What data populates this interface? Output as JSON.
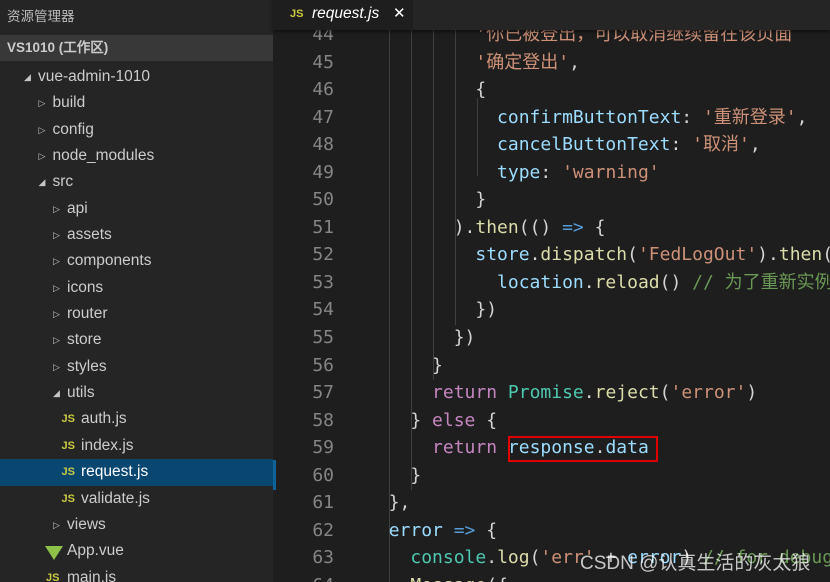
{
  "sidebar": {
    "title": "资源管理器",
    "workspace": "VS1010 (工作区)",
    "items": [
      {
        "label": "vue-admin-1010",
        "depth": 0,
        "type": "folder",
        "open": true
      },
      {
        "label": "build",
        "depth": 1,
        "type": "folder",
        "open": false
      },
      {
        "label": "config",
        "depth": 1,
        "type": "folder",
        "open": false
      },
      {
        "label": "node_modules",
        "depth": 1,
        "type": "folder",
        "open": false
      },
      {
        "label": "src",
        "depth": 1,
        "type": "folder",
        "open": true
      },
      {
        "label": "api",
        "depth": 2,
        "type": "folder",
        "open": false
      },
      {
        "label": "assets",
        "depth": 2,
        "type": "folder",
        "open": false
      },
      {
        "label": "components",
        "depth": 2,
        "type": "folder",
        "open": false
      },
      {
        "label": "icons",
        "depth": 2,
        "type": "folder",
        "open": false
      },
      {
        "label": "router",
        "depth": 2,
        "type": "folder",
        "open": false
      },
      {
        "label": "store",
        "depth": 2,
        "type": "folder",
        "open": false
      },
      {
        "label": "styles",
        "depth": 2,
        "type": "folder",
        "open": false
      },
      {
        "label": "utils",
        "depth": 2,
        "type": "folder",
        "open": true
      },
      {
        "label": "auth.js",
        "depth": 3,
        "type": "js"
      },
      {
        "label": "index.js",
        "depth": 3,
        "type": "js"
      },
      {
        "label": "request.js",
        "depth": 3,
        "type": "js",
        "selected": true
      },
      {
        "label": "validate.js",
        "depth": 3,
        "type": "js"
      },
      {
        "label": "views",
        "depth": 2,
        "type": "folder",
        "open": false
      },
      {
        "label": "App.vue",
        "depth": 2,
        "type": "vue"
      },
      {
        "label": "main.js",
        "depth": 2,
        "type": "js"
      }
    ]
  },
  "tab": {
    "icon_label": "JS",
    "name": "request.js",
    "close": "✕"
  },
  "icons": {
    "js": "JS",
    "folder_open": "◢",
    "folder_closed": "▷"
  },
  "colors": {
    "selection": "#094771",
    "highlight_box": "#e00000",
    "js_icon": "#cbcb41",
    "vue_icon": "#8dc149"
  },
  "code": [
    {
      "n": "44",
      "t": [
        [
          "          ",
          "p"
        ],
        [
          "'你已被登出，可以取消继续留在该页面",
          "s"
        ]
      ]
    },
    {
      "n": "45",
      "t": [
        [
          "          ",
          "p"
        ],
        [
          "'确定登出'",
          "s"
        ],
        [
          ",",
          "p"
        ]
      ]
    },
    {
      "n": "46",
      "t": [
        [
          "          {",
          "p"
        ]
      ]
    },
    {
      "n": "47",
      "t": [
        [
          "            ",
          "p"
        ],
        [
          "confirmButtonText",
          "v"
        ],
        [
          ": ",
          "p"
        ],
        [
          "'重新登录'",
          "s"
        ],
        [
          ",",
          "p"
        ]
      ]
    },
    {
      "n": "48",
      "t": [
        [
          "            ",
          "p"
        ],
        [
          "cancelButtonText",
          "v"
        ],
        [
          ": ",
          "p"
        ],
        [
          "'取消'",
          "s"
        ],
        [
          ",",
          "p"
        ]
      ]
    },
    {
      "n": "49",
      "t": [
        [
          "            ",
          "p"
        ],
        [
          "type",
          "v"
        ],
        [
          ": ",
          "p"
        ],
        [
          "'warning'",
          "s"
        ]
      ]
    },
    {
      "n": "50",
      "t": [
        [
          "          }",
          "p"
        ]
      ]
    },
    {
      "n": "51",
      "t": [
        [
          "        ).",
          "p"
        ],
        [
          "then",
          "f"
        ],
        [
          "(() ",
          "p"
        ],
        [
          "=>",
          "b"
        ],
        [
          " {",
          "p"
        ]
      ]
    },
    {
      "n": "52",
      "t": [
        [
          "          ",
          "p"
        ],
        [
          "store",
          "v"
        ],
        [
          ".",
          "p"
        ],
        [
          "dispatch",
          "f"
        ],
        [
          "(",
          "p"
        ],
        [
          "'FedLogOut'",
          "s"
        ],
        [
          ").",
          "p"
        ],
        [
          "then",
          "f"
        ],
        [
          "(() => {",
          "p"
        ]
      ]
    },
    {
      "n": "53",
      "t": [
        [
          "            ",
          "p"
        ],
        [
          "location",
          "v"
        ],
        [
          ".",
          "p"
        ],
        [
          "reload",
          "f"
        ],
        [
          "() ",
          "p"
        ],
        [
          "// 为了重新实例化vue-router对象",
          "m"
        ]
      ]
    },
    {
      "n": "54",
      "t": [
        [
          "          })",
          "p"
        ]
      ]
    },
    {
      "n": "55",
      "t": [
        [
          "        })",
          "p"
        ]
      ]
    },
    {
      "n": "56",
      "t": [
        [
          "      }",
          "p"
        ]
      ]
    },
    {
      "n": "57",
      "t": [
        [
          "      ",
          "p"
        ],
        [
          "return",
          "k"
        ],
        [
          " ",
          "p"
        ],
        [
          "Promise",
          "c"
        ],
        [
          ".",
          "p"
        ],
        [
          "reject",
          "f"
        ],
        [
          "(",
          "p"
        ],
        [
          "'error'",
          "s"
        ],
        [
          ")",
          "p"
        ]
      ]
    },
    {
      "n": "58",
      "t": [
        [
          "    } ",
          "p"
        ],
        [
          "else",
          "k"
        ],
        [
          " {",
          "p"
        ]
      ]
    },
    {
      "n": "59",
      "t": [
        [
          "      ",
          "p"
        ],
        [
          "return",
          "k"
        ],
        [
          " ",
          "p"
        ],
        [
          "response",
          "v"
        ],
        [
          ".",
          "p"
        ],
        [
          "data",
          "v"
        ]
      ]
    },
    {
      "n": "60",
      "t": [
        [
          "    }",
          "p"
        ]
      ]
    },
    {
      "n": "61",
      "t": [
        [
          "  },",
          "p"
        ]
      ]
    },
    {
      "n": "62",
      "t": [
        [
          "  ",
          "p"
        ],
        [
          "error",
          "v"
        ],
        [
          " ",
          "p"
        ],
        [
          "=>",
          "b"
        ],
        [
          " {",
          "p"
        ]
      ]
    },
    {
      "n": "63",
      "t": [
        [
          "    ",
          "p"
        ],
        [
          "console",
          "c"
        ],
        [
          ".",
          "p"
        ],
        [
          "log",
          "f"
        ],
        [
          "(",
          "p"
        ],
        [
          "'err'",
          "s"
        ],
        [
          " + ",
          "p"
        ],
        [
          "error",
          "v"
        ],
        [
          ") ",
          "p"
        ],
        [
          "// for debug",
          "m"
        ]
      ]
    },
    {
      "n": "64",
      "t": [
        [
          "    ",
          "p"
        ],
        [
          "Message",
          "f"
        ],
        [
          "({",
          "p"
        ]
      ]
    }
  ],
  "watermark": "CSDN @认真生活的灰太狼"
}
